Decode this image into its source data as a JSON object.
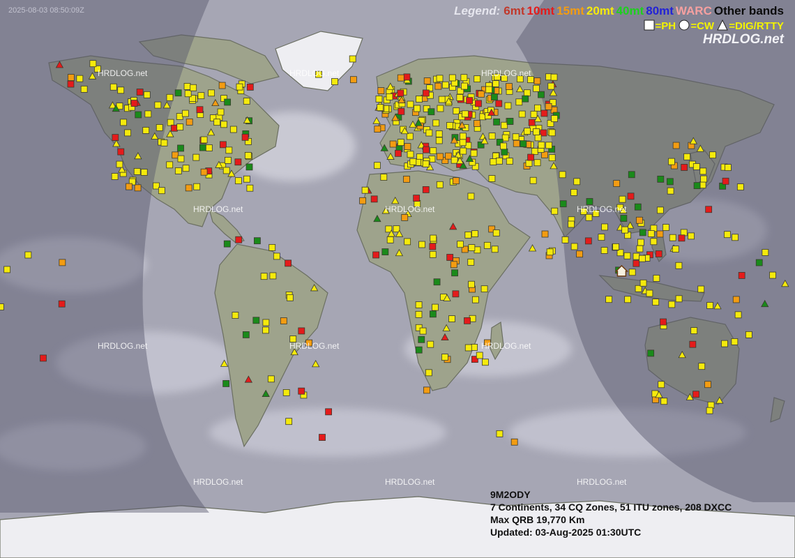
{
  "timestamp": "2025-08-03 08:50:09Z",
  "legend": {
    "title": "Legend:",
    "bands": [
      {
        "label": "6mt",
        "color": "#c0392b"
      },
      {
        "label": "10mt",
        "color": "#e41b1b"
      },
      {
        "label": "15mt",
        "color": "#f39c12"
      },
      {
        "label": "20mt",
        "color": "#f5ea0c"
      },
      {
        "label": "40mt",
        "color": "#1fcf1f"
      },
      {
        "label": "80mt",
        "color": "#2323d6"
      },
      {
        "label": "WARC",
        "color": "#f6a0a0"
      },
      {
        "label": "Other bands",
        "color": "#0b0b0b"
      }
    ],
    "modes": [
      {
        "symbol": "square-icon",
        "label": "=PH"
      },
      {
        "symbol": "circle-icon",
        "label": "=CW"
      },
      {
        "symbol": "triangle-icon",
        "label": "=DIG/RTTY"
      }
    ],
    "brand": "HRDLOG.net"
  },
  "watermark": "HRDLOG.net",
  "station": {
    "callsign": "9M2ODY",
    "summary": "7 Continents, 34 CQ Zones, 51 ITU zones, 208 DXCC",
    "max_qrb": "Max QRB 19,770 Km",
    "updated": "Updated: 03-Aug-2025 01:30UTC"
  },
  "home": {
    "icon": "home-icon",
    "lat": 2.5,
    "lon": 101.5
  },
  "colors": {
    "night": "#5e5e74",
    "day": "#c9c9d2",
    "land": "#9a9f88",
    "ice": "#f1f1f4"
  }
}
